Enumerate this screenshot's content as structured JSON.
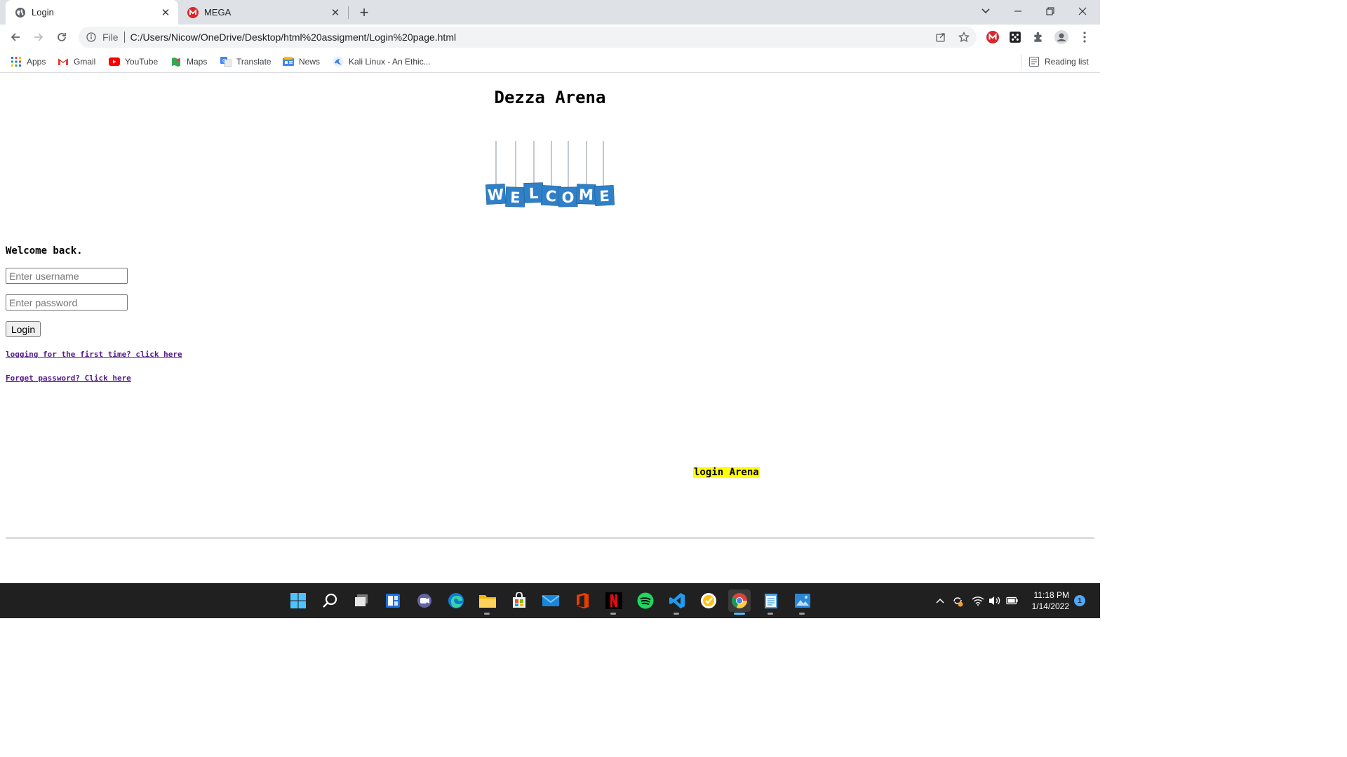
{
  "browser": {
    "tabs": [
      {
        "title": "Login",
        "active": true,
        "icon": "globe-icon"
      },
      {
        "title": "MEGA",
        "active": false,
        "icon": "mega-icon"
      }
    ],
    "new_tab_symbol": "+",
    "close_symbol": "✕",
    "window_controls": {
      "minimize": "—",
      "restore": "❐",
      "close": "✕",
      "tab_search": "⌄"
    },
    "address": {
      "scheme": "File",
      "url": "C:/Users/Nicow/OneDrive/Desktop/html%20assigment/Login%20page.html"
    },
    "bookmarks": [
      {
        "label": "Apps",
        "icon": "apps-grid-icon"
      },
      {
        "label": "Gmail",
        "icon": "gmail-icon"
      },
      {
        "label": "YouTube",
        "icon": "youtube-icon"
      },
      {
        "label": "Maps",
        "icon": "maps-icon"
      },
      {
        "label": "Translate",
        "icon": "translate-icon"
      },
      {
        "label": "News",
        "icon": "news-icon"
      },
      {
        "label": "Kali Linux - An Ethic...",
        "icon": "kali-icon"
      }
    ],
    "reading_list": "Reading list",
    "colors": {
      "tab_strip": "#dee1e6",
      "omnibox": "#f1f3f4",
      "link_visited": "#551a8b",
      "highlight": "#ffff00"
    }
  },
  "page": {
    "title": "Dezza Arena",
    "welcome_image": {
      "letters": [
        "W",
        "E",
        "L",
        "C",
        "O",
        "M",
        "E"
      ],
      "color": "#2f80c7"
    },
    "welcome_back": "Welcome back.",
    "username_placeholder": "Enter username",
    "password_placeholder": "Enter password",
    "login_button": "Login",
    "first_time_link": "logging for the first time? click here",
    "forgot_link": "Forget password? Click here",
    "marquee": "login Arena"
  },
  "taskbar": {
    "apps": [
      "start-icon",
      "search-icon",
      "task-view-icon",
      "widgets-icon",
      "teams-chat-icon",
      "edge-icon",
      "file-explorer-icon",
      "store-icon",
      "mail-icon",
      "office-icon",
      "netflix-icon",
      "spotify-icon",
      "vscode-icon",
      "norton-icon",
      "chrome-icon",
      "notepad-icon",
      "photos-icon"
    ],
    "time": "11:18 PM",
    "date": "1/14/2022",
    "notification_count": "1"
  }
}
